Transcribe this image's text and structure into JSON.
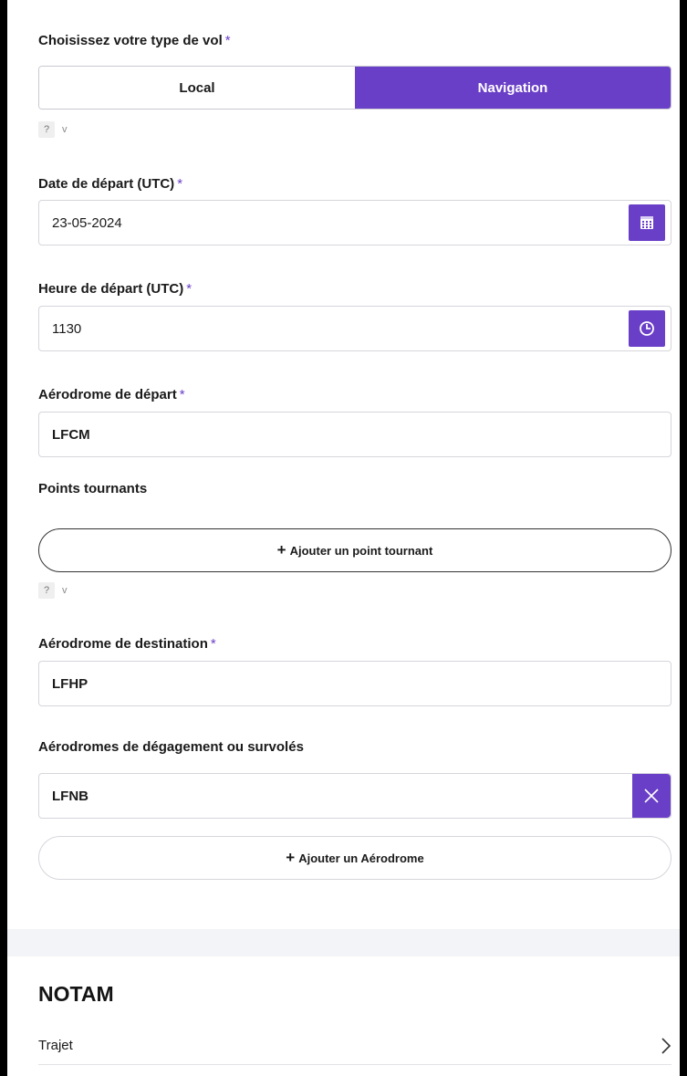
{
  "flight_type": {
    "label": "Choisissez votre type de vol",
    "required_mark": "*",
    "options": [
      "Local",
      "Navigation"
    ],
    "selected": "Navigation",
    "help": {
      "q": "?",
      "toggle": "v"
    }
  },
  "departure_date": {
    "label": "Date de départ (UTC)",
    "required_mark": "*",
    "value": "23-05-2024",
    "icon": "calendar-icon"
  },
  "departure_time": {
    "label": "Heure de départ (UTC)",
    "required_mark": "*",
    "value": "1130",
    "icon": "clock-icon"
  },
  "departure_aerodrome": {
    "label": "Aérodrome de départ",
    "required_mark": "*",
    "value": "LFCM"
  },
  "turning_points": {
    "label": "Points tournants",
    "add_button": "Ajouter un point tournant",
    "help": {
      "q": "?",
      "toggle": "v"
    }
  },
  "destination_aerodrome": {
    "label": "Aérodrome de destination",
    "required_mark": "*",
    "value": "LFHP"
  },
  "alternate_aerodromes": {
    "label": "Aérodromes de dégagement ou survolés",
    "items": [
      {
        "value": "LFNB"
      }
    ],
    "add_button": "Ajouter un Aérodrome",
    "plus": "+"
  },
  "notam": {
    "title": "NOTAM",
    "item": "Trajet"
  },
  "colors": {
    "accent": "#6a3fc7",
    "border": "#d6d6dc",
    "band": "#f3f4f7"
  }
}
